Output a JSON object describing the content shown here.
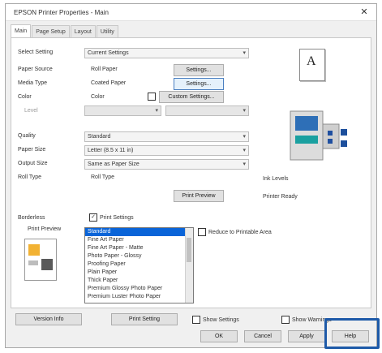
{
  "window": {
    "title": "EPSON Printer Properties - Main"
  },
  "tabs": [
    "Main",
    "Page Setup",
    "Layout",
    "Utility"
  ],
  "main": {
    "quick_settings": {
      "label": "Select Setting",
      "value": "Current Settings"
    },
    "paper_source": {
      "label": "Paper Source",
      "value": "Roll Paper",
      "button": "Settings..."
    },
    "media_type": {
      "label": "Media Type",
      "value": "Coated Paper",
      "button": "Settings..."
    },
    "color": {
      "label": "Color",
      "value": "Color",
      "button": "Custom Settings..."
    },
    "sub_field": {
      "label": "Level",
      "value": "",
      "value2": ""
    },
    "quality": {
      "label": "Quality",
      "value": "Standard"
    },
    "page_size": {
      "label": "Paper Size",
      "value": "Letter (8.5 x 11 in)"
    },
    "output_size": {
      "label": "Output Size",
      "value": "Same as Paper Size"
    },
    "roll_type": {
      "label": "Roll Type",
      "value": "Roll Type"
    },
    "print_preview_button": "Print Preview",
    "status_label1": "Ink Levels",
    "status_label2": "Printer Ready"
  },
  "preview": {
    "letter": "A"
  },
  "layout": {
    "group_label": "Borderless",
    "checkbox_label": "Print Settings",
    "sub_label": "Print Preview",
    "right_checkbox": "Reduce to Printable Area",
    "list_items": [
      "Standard",
      "Fine Art Paper",
      "Fine Art Paper - Matte",
      "Photo Paper - Glossy",
      "Proofing Paper",
      "Plain Paper",
      "Thick Paper",
      "Premium Glossy Photo Paper",
      "Premium Luster Photo Paper"
    ],
    "selected_index": 0
  },
  "bottom_bar": {
    "button1": "Version Info",
    "button2": "Print Setting",
    "checkbox1": "Show Settings",
    "checkbox2": "Show Warnings"
  },
  "footer_buttons": {
    "ok": "OK",
    "cancel": "Cancel",
    "apply": "Apply",
    "help": "Help"
  }
}
